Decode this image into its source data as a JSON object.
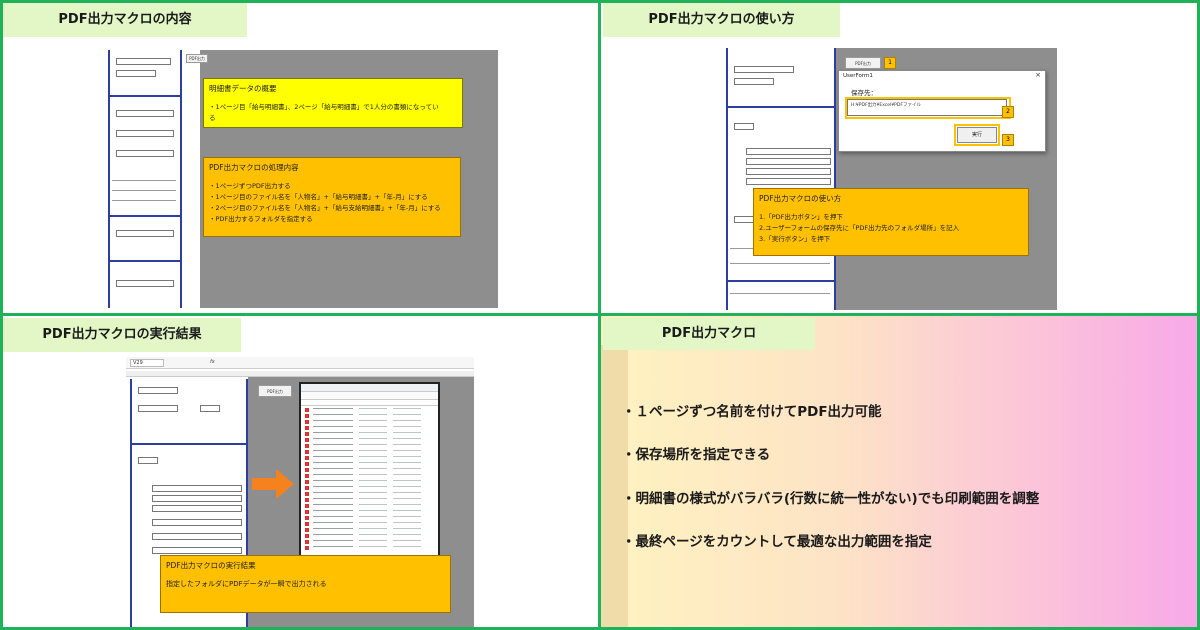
{
  "panels": {
    "top_left": {
      "tab_label": "PDF出力マクロの内容",
      "note_overview": {
        "title": "明細書データの概要",
        "line1": "・1ページ目「給与明細書」、2ページ「給与明細書」で1人分の書類になってい",
        "line2": "る"
      },
      "note_process": {
        "title": "PDF出力マクロの処理内容",
        "lines": [
          "・1ページずつPDF出力する",
          "・1ページ目のファイル名を「人物名」+「給与明細書」+「年-月」にする",
          "・2ページ目のファイル名を「人物名」+「給与支給明細書」+「年-月」にする",
          "・PDF出力するフォルダを指定する"
        ]
      },
      "button_label": "PDF出力"
    },
    "top_right": {
      "tab_label": "PDF出力マクロの使い方",
      "button_label": "PDF出力",
      "userform": {
        "title": "UserForm1",
        "close": "×",
        "save_label": "保存先：",
        "path_value": "H:¥PDF出力¥Excel¥PDFファイル",
        "exec_label": "実行"
      },
      "badges": [
        "1",
        "2",
        "3"
      ],
      "note_usage": {
        "title": "PDF出力マクロの使い方",
        "lines": [
          "1.「PDF出力ボタン」を押下",
          "2.ユーザーフォームの保存先に「PDF出力先のフォルダ場所」を記入",
          "3.「実行ボタン」を押下"
        ]
      }
    },
    "bottom_left": {
      "tab_label": "PDF出力マクロの実行結果",
      "cell_ref": "V29",
      "formula_icon": "fx",
      "button_label": "PDF出力",
      "note_result": {
        "title": "PDF出力マクロの実行結果",
        "line": "指定したフォルダにPDFデータが一瞬で出力される"
      },
      "explorer_rows_count_label": "",
      "colors": {
        "arrow": "#f5821f"
      }
    },
    "bottom_right": {
      "tab_label": "PDF出力マクロ",
      "items": [
        "・１ページずつ名前を付けてPDF出力可能",
        "・保存場所を指定できる",
        "・明細書の様式がバラバラ(行数に統一性がない)でも印刷範囲を調整",
        "・最終ページをカウントして最適な出力範囲を指定"
      ]
    }
  },
  "colors": {
    "frame": "#1fb25a",
    "tab_bg": "#e3f7c6",
    "note_yellow": "#ffff00",
    "note_orange": "#ffc000",
    "sheet_grey": "#8e8e8e"
  }
}
